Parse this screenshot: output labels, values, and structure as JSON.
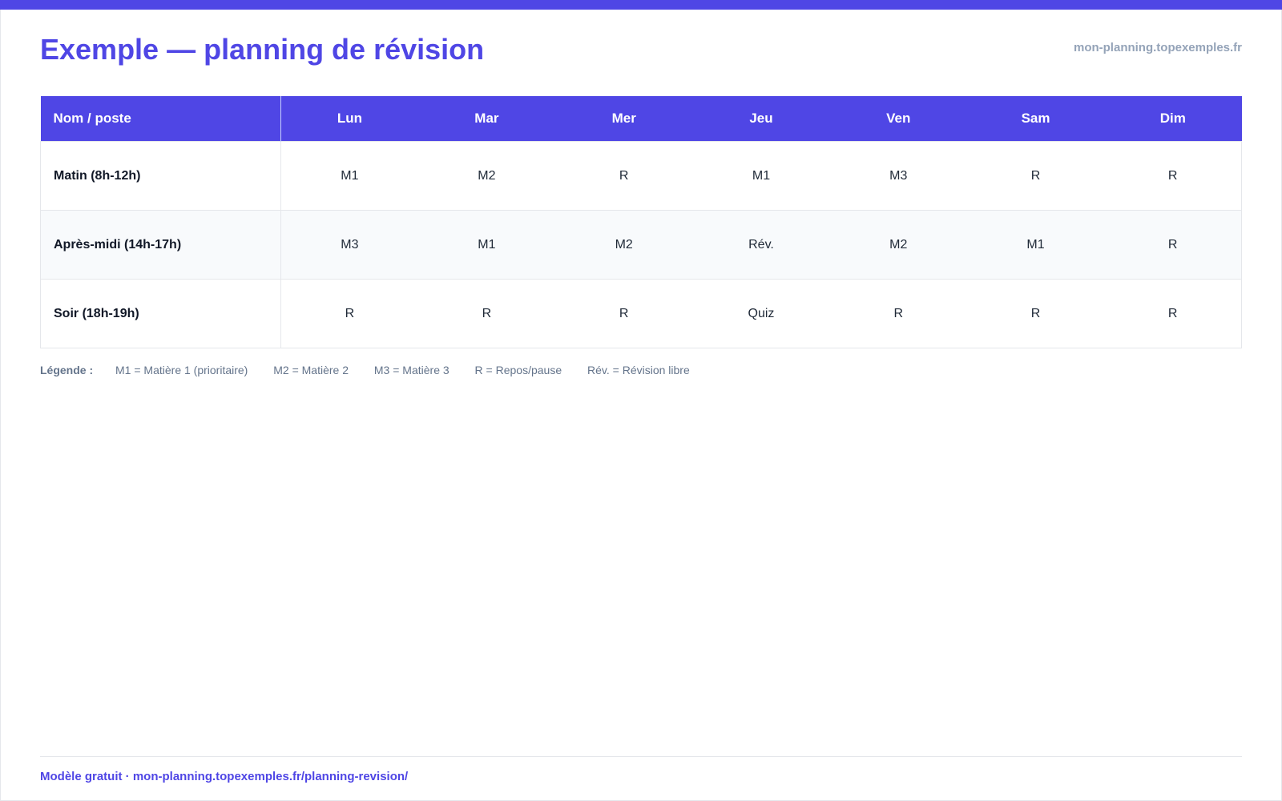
{
  "header": {
    "title": "Exemple — planning de révision",
    "site": "mon-planning.topexemples.fr"
  },
  "table": {
    "corner_label": "Nom / poste",
    "days": [
      "Lun",
      "Mar",
      "Mer",
      "Jeu",
      "Ven",
      "Sam",
      "Dim"
    ],
    "rows": [
      {
        "label": "Matin (8h-12h)",
        "cells": [
          "M1",
          "M2",
          "R",
          "M1",
          "M3",
          "R",
          "R"
        ]
      },
      {
        "label": "Après-midi (14h-17h)",
        "cells": [
          "M3",
          "M1",
          "M2",
          "Rév.",
          "M2",
          "M1",
          "R"
        ]
      },
      {
        "label": "Soir (18h-19h)",
        "cells": [
          "R",
          "R",
          "R",
          "Quiz",
          "R",
          "R",
          "R"
        ]
      }
    ]
  },
  "legend": {
    "title": "Légende :",
    "items": [
      "M1 = Matière 1 (prioritaire)",
      "M2 = Matière 2",
      "M3 = Matière 3",
      "R = Repos/pause",
      "Rév. = Révision libre"
    ]
  },
  "footer": {
    "text": "Modèle gratuit · mon-planning.topexemples.fr/planning-revision/"
  },
  "colors": {
    "accent": "#4f46e5",
    "muted": "#94a3b8",
    "stripe": "#f8fafc"
  }
}
